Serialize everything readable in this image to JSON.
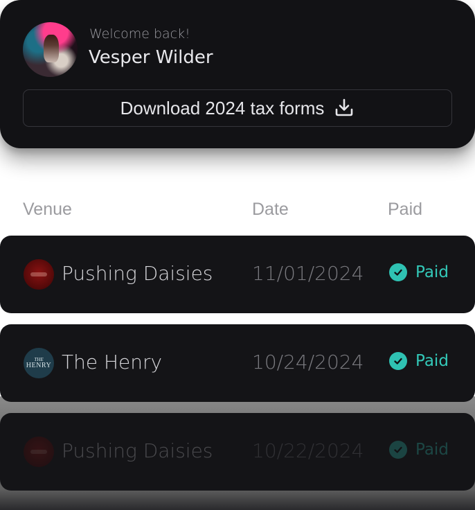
{
  "header": {
    "welcome": "Welcome back!",
    "user_name": "Vesper Wilder",
    "download_label": "Download 2024 tax forms"
  },
  "table": {
    "columns": [
      "Venue",
      "Date",
      "Paid"
    ],
    "rows": [
      {
        "venue": "Pushing Daisies",
        "date": "11/01/2024",
        "status": "Paid",
        "logo": "pushing-daisies-logo"
      },
      {
        "venue": "The Henry",
        "date": "10/24/2024",
        "status": "Paid",
        "logo": "the-henry-logo",
        "logo_text": [
          "THE",
          "HENRY"
        ]
      },
      {
        "venue": "Pushing Daisies",
        "date": "10/22/2024",
        "status": "Paid",
        "logo": "pushing-daisies-logo"
      }
    ]
  },
  "colors": {
    "card_bg": "#121215",
    "row_bg": "#141417",
    "paid_accent": "#33c9b9"
  }
}
